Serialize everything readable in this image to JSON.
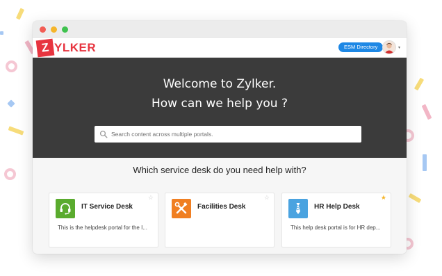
{
  "window": {
    "controls": [
      "close",
      "minimize",
      "maximize"
    ]
  },
  "header": {
    "logo_initial": "Z",
    "logo_rest": "YLKER",
    "esm_button": "ESM Directory",
    "avatar_icon": "user-avatar-icon",
    "caret": "▾"
  },
  "hero": {
    "line1": "Welcome to Zylker.",
    "line2": "How can we help you ?",
    "search_placeholder": "Search content across multiple portals.",
    "search_icon": "search-icon"
  },
  "section": {
    "question": "Which service desk do you need help with?"
  },
  "cards": [
    {
      "title": "IT Service Desk",
      "description": "This is the helpdesk portal for the I...",
      "icon": "headset-icon",
      "icon_color": "#5aab2e",
      "starred": false
    },
    {
      "title": "Facilities Desk",
      "description": "",
      "icon": "tools-icon",
      "icon_color": "#f07f22",
      "starred": false
    },
    {
      "title": "HR Help Desk",
      "description": "This help desk portal is for HR dep...",
      "icon": "necktie-icon",
      "icon_color": "#4aa3e0",
      "starred": true
    }
  ],
  "colors": {
    "brand": "#e7343f",
    "hero_bg": "#3b3b3b",
    "accent": "#1e88e5",
    "star_on": "#f5b52b",
    "star_off": "#c8c8c8"
  }
}
